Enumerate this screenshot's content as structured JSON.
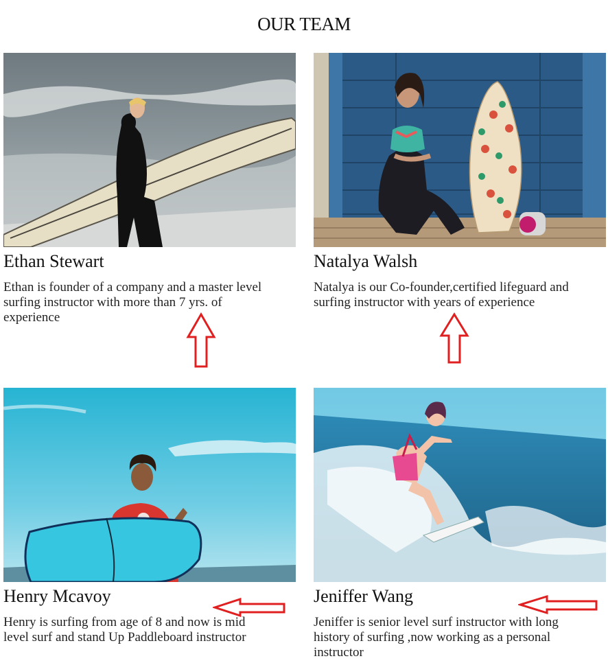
{
  "page": {
    "title": "OUR TEAM"
  },
  "team": [
    {
      "name": "Ethan Stewart",
      "bio": "Ethan is founder of a company and a master level surfing instructor with more than 7 yrs. of experience",
      "photo_icon": "surfer-with-longboard-photo"
    },
    {
      "name": "Natalya Walsh",
      "bio": "Natalya is our Co-founder,certified lifeguard and surfing instructor with years of experience",
      "photo_icon": "woman-sitting-with-board-photo"
    },
    {
      "name": "Henry Mcavoy",
      "bio": "Henry is surfing from age of 8 and now is mid level surf and stand Up Paddleboard instructor",
      "photo_icon": "surfer-with-blue-board-photo"
    },
    {
      "name": "Jeniffer Wang",
      "bio": "Jeniffer is senior level surf instructor with long history of surfing ,now working as a personal instructor",
      "photo_icon": "woman-riding-wave-photo"
    }
  ],
  "annotations": {
    "arrow_color": "#e02020"
  }
}
